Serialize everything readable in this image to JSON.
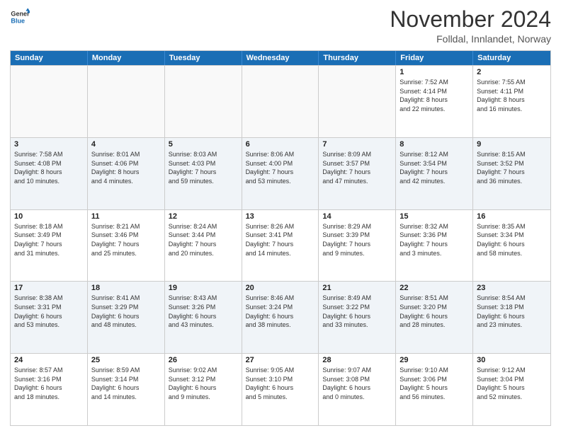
{
  "logo": {
    "line1": "General",
    "line2": "Blue"
  },
  "title": "November 2024",
  "location": "Folldal, Innlandet, Norway",
  "days_of_week": [
    "Sunday",
    "Monday",
    "Tuesday",
    "Wednesday",
    "Thursday",
    "Friday",
    "Saturday"
  ],
  "weeks": [
    [
      {
        "day": "",
        "info": ""
      },
      {
        "day": "",
        "info": ""
      },
      {
        "day": "",
        "info": ""
      },
      {
        "day": "",
        "info": ""
      },
      {
        "day": "",
        "info": ""
      },
      {
        "day": "1",
        "info": "Sunrise: 7:52 AM\nSunset: 4:14 PM\nDaylight: 8 hours\nand 22 minutes."
      },
      {
        "day": "2",
        "info": "Sunrise: 7:55 AM\nSunset: 4:11 PM\nDaylight: 8 hours\nand 16 minutes."
      }
    ],
    [
      {
        "day": "3",
        "info": "Sunrise: 7:58 AM\nSunset: 4:08 PM\nDaylight: 8 hours\nand 10 minutes."
      },
      {
        "day": "4",
        "info": "Sunrise: 8:01 AM\nSunset: 4:06 PM\nDaylight: 8 hours\nand 4 minutes."
      },
      {
        "day": "5",
        "info": "Sunrise: 8:03 AM\nSunset: 4:03 PM\nDaylight: 7 hours\nand 59 minutes."
      },
      {
        "day": "6",
        "info": "Sunrise: 8:06 AM\nSunset: 4:00 PM\nDaylight: 7 hours\nand 53 minutes."
      },
      {
        "day": "7",
        "info": "Sunrise: 8:09 AM\nSunset: 3:57 PM\nDaylight: 7 hours\nand 47 minutes."
      },
      {
        "day": "8",
        "info": "Sunrise: 8:12 AM\nSunset: 3:54 PM\nDaylight: 7 hours\nand 42 minutes."
      },
      {
        "day": "9",
        "info": "Sunrise: 8:15 AM\nSunset: 3:52 PM\nDaylight: 7 hours\nand 36 minutes."
      }
    ],
    [
      {
        "day": "10",
        "info": "Sunrise: 8:18 AM\nSunset: 3:49 PM\nDaylight: 7 hours\nand 31 minutes."
      },
      {
        "day": "11",
        "info": "Sunrise: 8:21 AM\nSunset: 3:46 PM\nDaylight: 7 hours\nand 25 minutes."
      },
      {
        "day": "12",
        "info": "Sunrise: 8:24 AM\nSunset: 3:44 PM\nDaylight: 7 hours\nand 20 minutes."
      },
      {
        "day": "13",
        "info": "Sunrise: 8:26 AM\nSunset: 3:41 PM\nDaylight: 7 hours\nand 14 minutes."
      },
      {
        "day": "14",
        "info": "Sunrise: 8:29 AM\nSunset: 3:39 PM\nDaylight: 7 hours\nand 9 minutes."
      },
      {
        "day": "15",
        "info": "Sunrise: 8:32 AM\nSunset: 3:36 PM\nDaylight: 7 hours\nand 3 minutes."
      },
      {
        "day": "16",
        "info": "Sunrise: 8:35 AM\nSunset: 3:34 PM\nDaylight: 6 hours\nand 58 minutes."
      }
    ],
    [
      {
        "day": "17",
        "info": "Sunrise: 8:38 AM\nSunset: 3:31 PM\nDaylight: 6 hours\nand 53 minutes."
      },
      {
        "day": "18",
        "info": "Sunrise: 8:41 AM\nSunset: 3:29 PM\nDaylight: 6 hours\nand 48 minutes."
      },
      {
        "day": "19",
        "info": "Sunrise: 8:43 AM\nSunset: 3:26 PM\nDaylight: 6 hours\nand 43 minutes."
      },
      {
        "day": "20",
        "info": "Sunrise: 8:46 AM\nSunset: 3:24 PM\nDaylight: 6 hours\nand 38 minutes."
      },
      {
        "day": "21",
        "info": "Sunrise: 8:49 AM\nSunset: 3:22 PM\nDaylight: 6 hours\nand 33 minutes."
      },
      {
        "day": "22",
        "info": "Sunrise: 8:51 AM\nSunset: 3:20 PM\nDaylight: 6 hours\nand 28 minutes."
      },
      {
        "day": "23",
        "info": "Sunrise: 8:54 AM\nSunset: 3:18 PM\nDaylight: 6 hours\nand 23 minutes."
      }
    ],
    [
      {
        "day": "24",
        "info": "Sunrise: 8:57 AM\nSunset: 3:16 PM\nDaylight: 6 hours\nand 18 minutes."
      },
      {
        "day": "25",
        "info": "Sunrise: 8:59 AM\nSunset: 3:14 PM\nDaylight: 6 hours\nand 14 minutes."
      },
      {
        "day": "26",
        "info": "Sunrise: 9:02 AM\nSunset: 3:12 PM\nDaylight: 6 hours\nand 9 minutes."
      },
      {
        "day": "27",
        "info": "Sunrise: 9:05 AM\nSunset: 3:10 PM\nDaylight: 6 hours\nand 5 minutes."
      },
      {
        "day": "28",
        "info": "Sunrise: 9:07 AM\nSunset: 3:08 PM\nDaylight: 6 hours\nand 0 minutes."
      },
      {
        "day": "29",
        "info": "Sunrise: 9:10 AM\nSunset: 3:06 PM\nDaylight: 5 hours\nand 56 minutes."
      },
      {
        "day": "30",
        "info": "Sunrise: 9:12 AM\nSunset: 3:04 PM\nDaylight: 5 hours\nand 52 minutes."
      }
    ]
  ]
}
